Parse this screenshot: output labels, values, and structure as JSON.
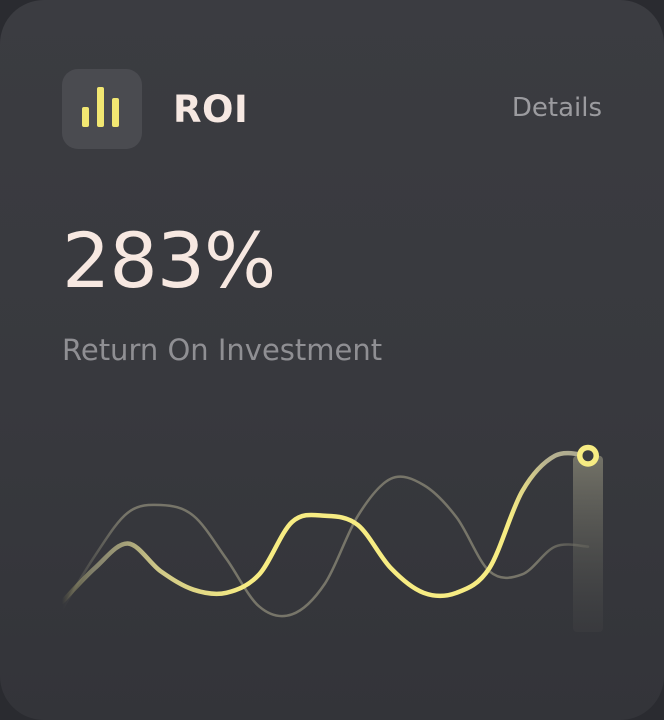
{
  "header": {
    "title": "ROI",
    "details_label": "Details",
    "icon": "bar-chart-icon"
  },
  "metric": {
    "value": "283%",
    "label": "Return On Investment"
  },
  "colors": {
    "card_background": "#3a3b40",
    "accent": "#f7ec83",
    "secondary_line": "#7e7c6e",
    "title_text": "#f6e8e2",
    "muted_text": "#8f8f93"
  },
  "chart_data": {
    "type": "line",
    "title": "",
    "xlabel": "",
    "ylabel": "",
    "grid": false,
    "legend": "none",
    "ylim": [
      0,
      100
    ],
    "x": [
      0,
      1,
      2,
      3,
      4,
      5,
      6,
      7,
      8,
      9,
      10,
      11,
      12,
      13,
      14,
      15,
      16
    ],
    "series": [
      {
        "role": "primary",
        "color": "#f7ec83",
        "values": [
          0,
          22,
          38,
          20,
          8,
          6,
          18,
          52,
          56,
          50,
          22,
          6,
          6,
          22,
          72,
          95,
          95
        ]
      },
      {
        "role": "secondary",
        "color": "#7e7c6e",
        "values": [
          -5,
          30,
          58,
          63,
          56,
          28,
          -3,
          -8,
          12,
          56,
          80,
          76,
          55,
          20,
          18,
          36,
          36
        ]
      }
    ],
    "highlight": {
      "index": 16,
      "series": "primary"
    }
  }
}
